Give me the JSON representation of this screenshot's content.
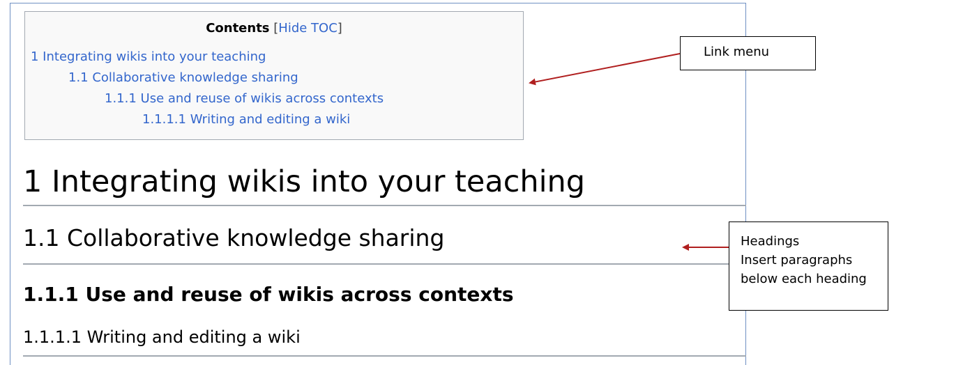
{
  "toc": {
    "title": "Contents",
    "bracket_open": " [",
    "toggle_label": "Hide TOC",
    "bracket_close": "]",
    "items": [
      {
        "label": "1 Integrating wikis into your teaching",
        "level": 1
      },
      {
        "label": "1.1 Collaborative knowledge sharing",
        "level": 2
      },
      {
        "label": "1.1.1 Use and reuse of wikis across contexts",
        "level": 3
      },
      {
        "label": "1.1.1.1 Writing and editing a wiki",
        "level": 4
      }
    ]
  },
  "headings": {
    "h1": "1 Integrating wikis into your teaching",
    "h2": "1.1 Collaborative knowledge sharing",
    "h3": "1.1.1 Use and reuse of wikis across contexts",
    "h4": "1.1.1.1 Writing and editing a wiki"
  },
  "callouts": {
    "link_menu": "Link menu",
    "headings_lines": [
      "Headings",
      "Insert paragraphs",
      "below each heading"
    ]
  },
  "colors": {
    "link": "#3366cc",
    "arrow": "#b01f1f",
    "frame": "#6f90c3",
    "toc_bg": "#f9f9f9"
  }
}
